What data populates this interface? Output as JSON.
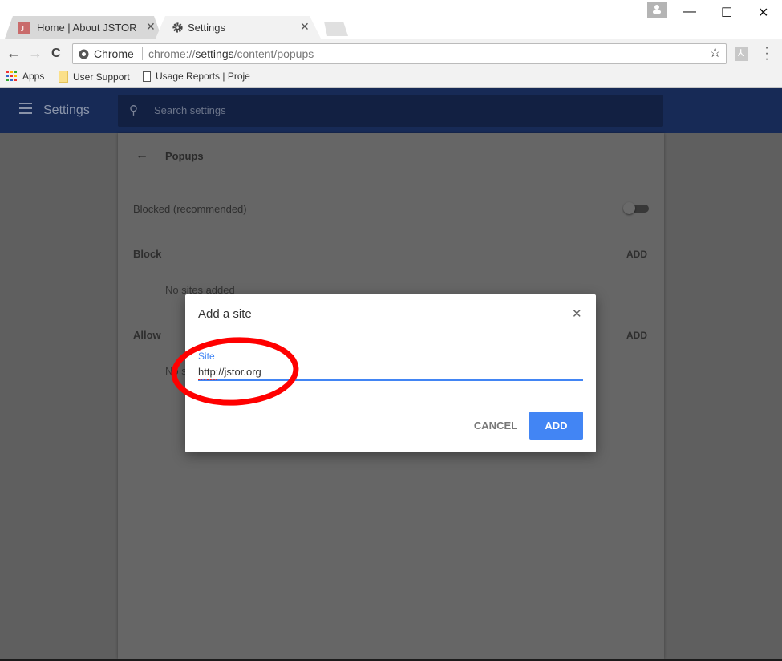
{
  "browser": {
    "tabs": [
      {
        "title": "Home | About JSTOR",
        "favicon": "jstor-favicon",
        "active": false
      },
      {
        "title": "Settings",
        "favicon": "gear-icon",
        "active": true
      }
    ],
    "tab_close_glyph": "✕",
    "window_controls": {
      "minimize": "—",
      "maximize": "☐",
      "close": "✕"
    },
    "omnibox": {
      "chip": "Chrome",
      "url_prefix": "chrome://",
      "url_host": "settings",
      "url_path": "/content/popups"
    },
    "nav": {
      "back": "←",
      "forward": "→",
      "reload": "C"
    },
    "bookmarks": [
      {
        "label": "Apps",
        "icon": "apps-grid-icon"
      },
      {
        "label": "User Support",
        "icon": "folder-icon"
      },
      {
        "label": "Usage Reports | Proje",
        "icon": "page-icon"
      }
    ]
  },
  "settings": {
    "header_title": "Settings",
    "search_placeholder": "Search settings",
    "page_title": "Popups",
    "toggle_label": "Blocked (recommended)",
    "toggle_on": false,
    "sections": [
      {
        "title": "Block",
        "action": "ADD",
        "empty": "No sites added"
      },
      {
        "title": "Allow",
        "action": "ADD",
        "empty": "No sites added"
      }
    ]
  },
  "dialog": {
    "title": "Add a site",
    "field_label": "Site",
    "field_value": "http://jstor.org",
    "cancel_label": "CANCEL",
    "add_label": "ADD",
    "close_glyph": "✕"
  },
  "colors": {
    "header": "#172a56",
    "accent": "#4285f4",
    "annotation": "#ff0000"
  }
}
